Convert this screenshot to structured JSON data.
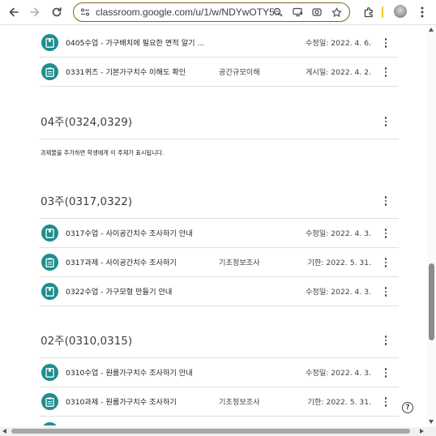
{
  "browser": {
    "url": "classroom.google.com/u/1/w/NDYwOTY5..."
  },
  "rows_top": [
    {
      "title": "0405수업 - 가구배치에 필요한 면적 알기 ...",
      "topic": "",
      "date": "수정일: 2022. 4. 6.",
      "type": "material"
    },
    {
      "title": "0331퀴즈 - 기본가구치수 이해도 확인",
      "topic": "공간규모이해",
      "date": "게시일: 2022. 4. 2.",
      "type": "assignment"
    }
  ],
  "sections": [
    {
      "title": "04주(0324,0329)",
      "empty_message": "과제물을 추가하면 학생에게 이 주제가 표시됩니다."
    },
    {
      "title": "03주(0317,0322)"
    },
    {
      "title": "02주(0310,0315)"
    }
  ],
  "rows_03": [
    {
      "title": "0317수업 - 사이공간치수 조사하기 안내",
      "topic": "",
      "date": "수정일: 2022. 4. 3.",
      "type": "material"
    },
    {
      "title": "0317과제 - 사이공간치수 조사하기",
      "topic": "기초정보조사",
      "date": "기한: 2022. 5. 31.",
      "type": "assignment"
    },
    {
      "title": "0322수업 - 가구모형 만들기 안내",
      "topic": "",
      "date": "수정일: 2022. 4. 3.",
      "type": "material"
    }
  ],
  "rows_02": [
    {
      "title": "0310수업 - 원룸가구치수 조사하기 안내",
      "topic": "",
      "date": "수정일: 2022. 4. 3.",
      "type": "material"
    },
    {
      "title": "0310과제 - 원룸가구치수 조사하기",
      "topic": "기초정보조사",
      "date": "기한: 2022. 5. 31.",
      "type": "assignment"
    }
  ],
  "help": "?"
}
